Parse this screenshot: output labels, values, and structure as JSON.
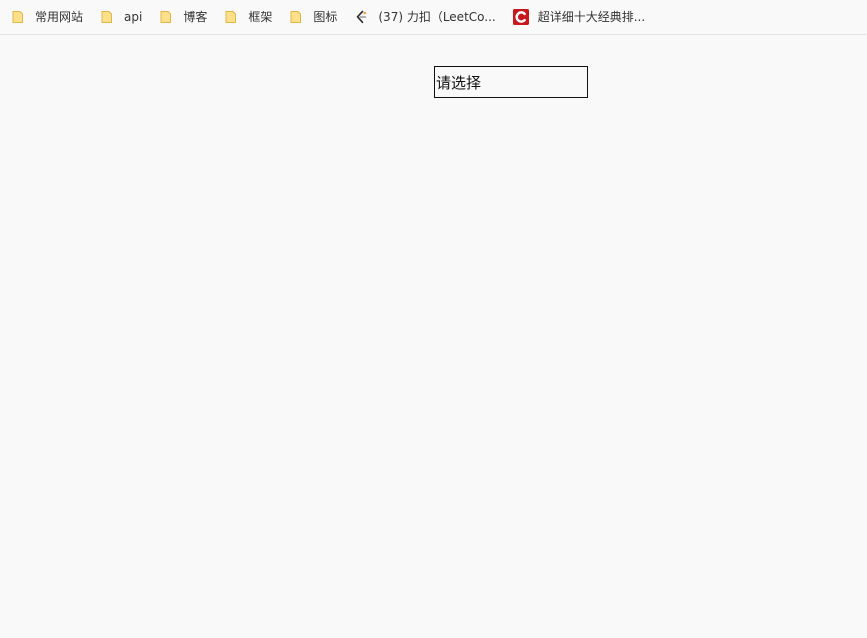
{
  "bookmarks": [
    {
      "label": "常用网站",
      "icon": "folder-icon"
    },
    {
      "label": "api",
      "icon": "folder-icon"
    },
    {
      "label": "博客",
      "icon": "folder-icon"
    },
    {
      "label": "框架",
      "icon": "folder-icon"
    },
    {
      "label": "图标",
      "icon": "folder-icon"
    },
    {
      "label": "(37) 力扣（LeetCo...",
      "icon": "leetcode-icon"
    },
    {
      "label": "超详细十大经典排...",
      "icon": "csdn-icon"
    }
  ],
  "select": {
    "placeholder": "请选择"
  },
  "colors": {
    "background": "#f9f9f9",
    "folder_fill": "#ffe08a",
    "folder_stroke": "#e0b648",
    "csdn_red": "#c9171e",
    "leetcode_orange": "#f0a03c"
  }
}
